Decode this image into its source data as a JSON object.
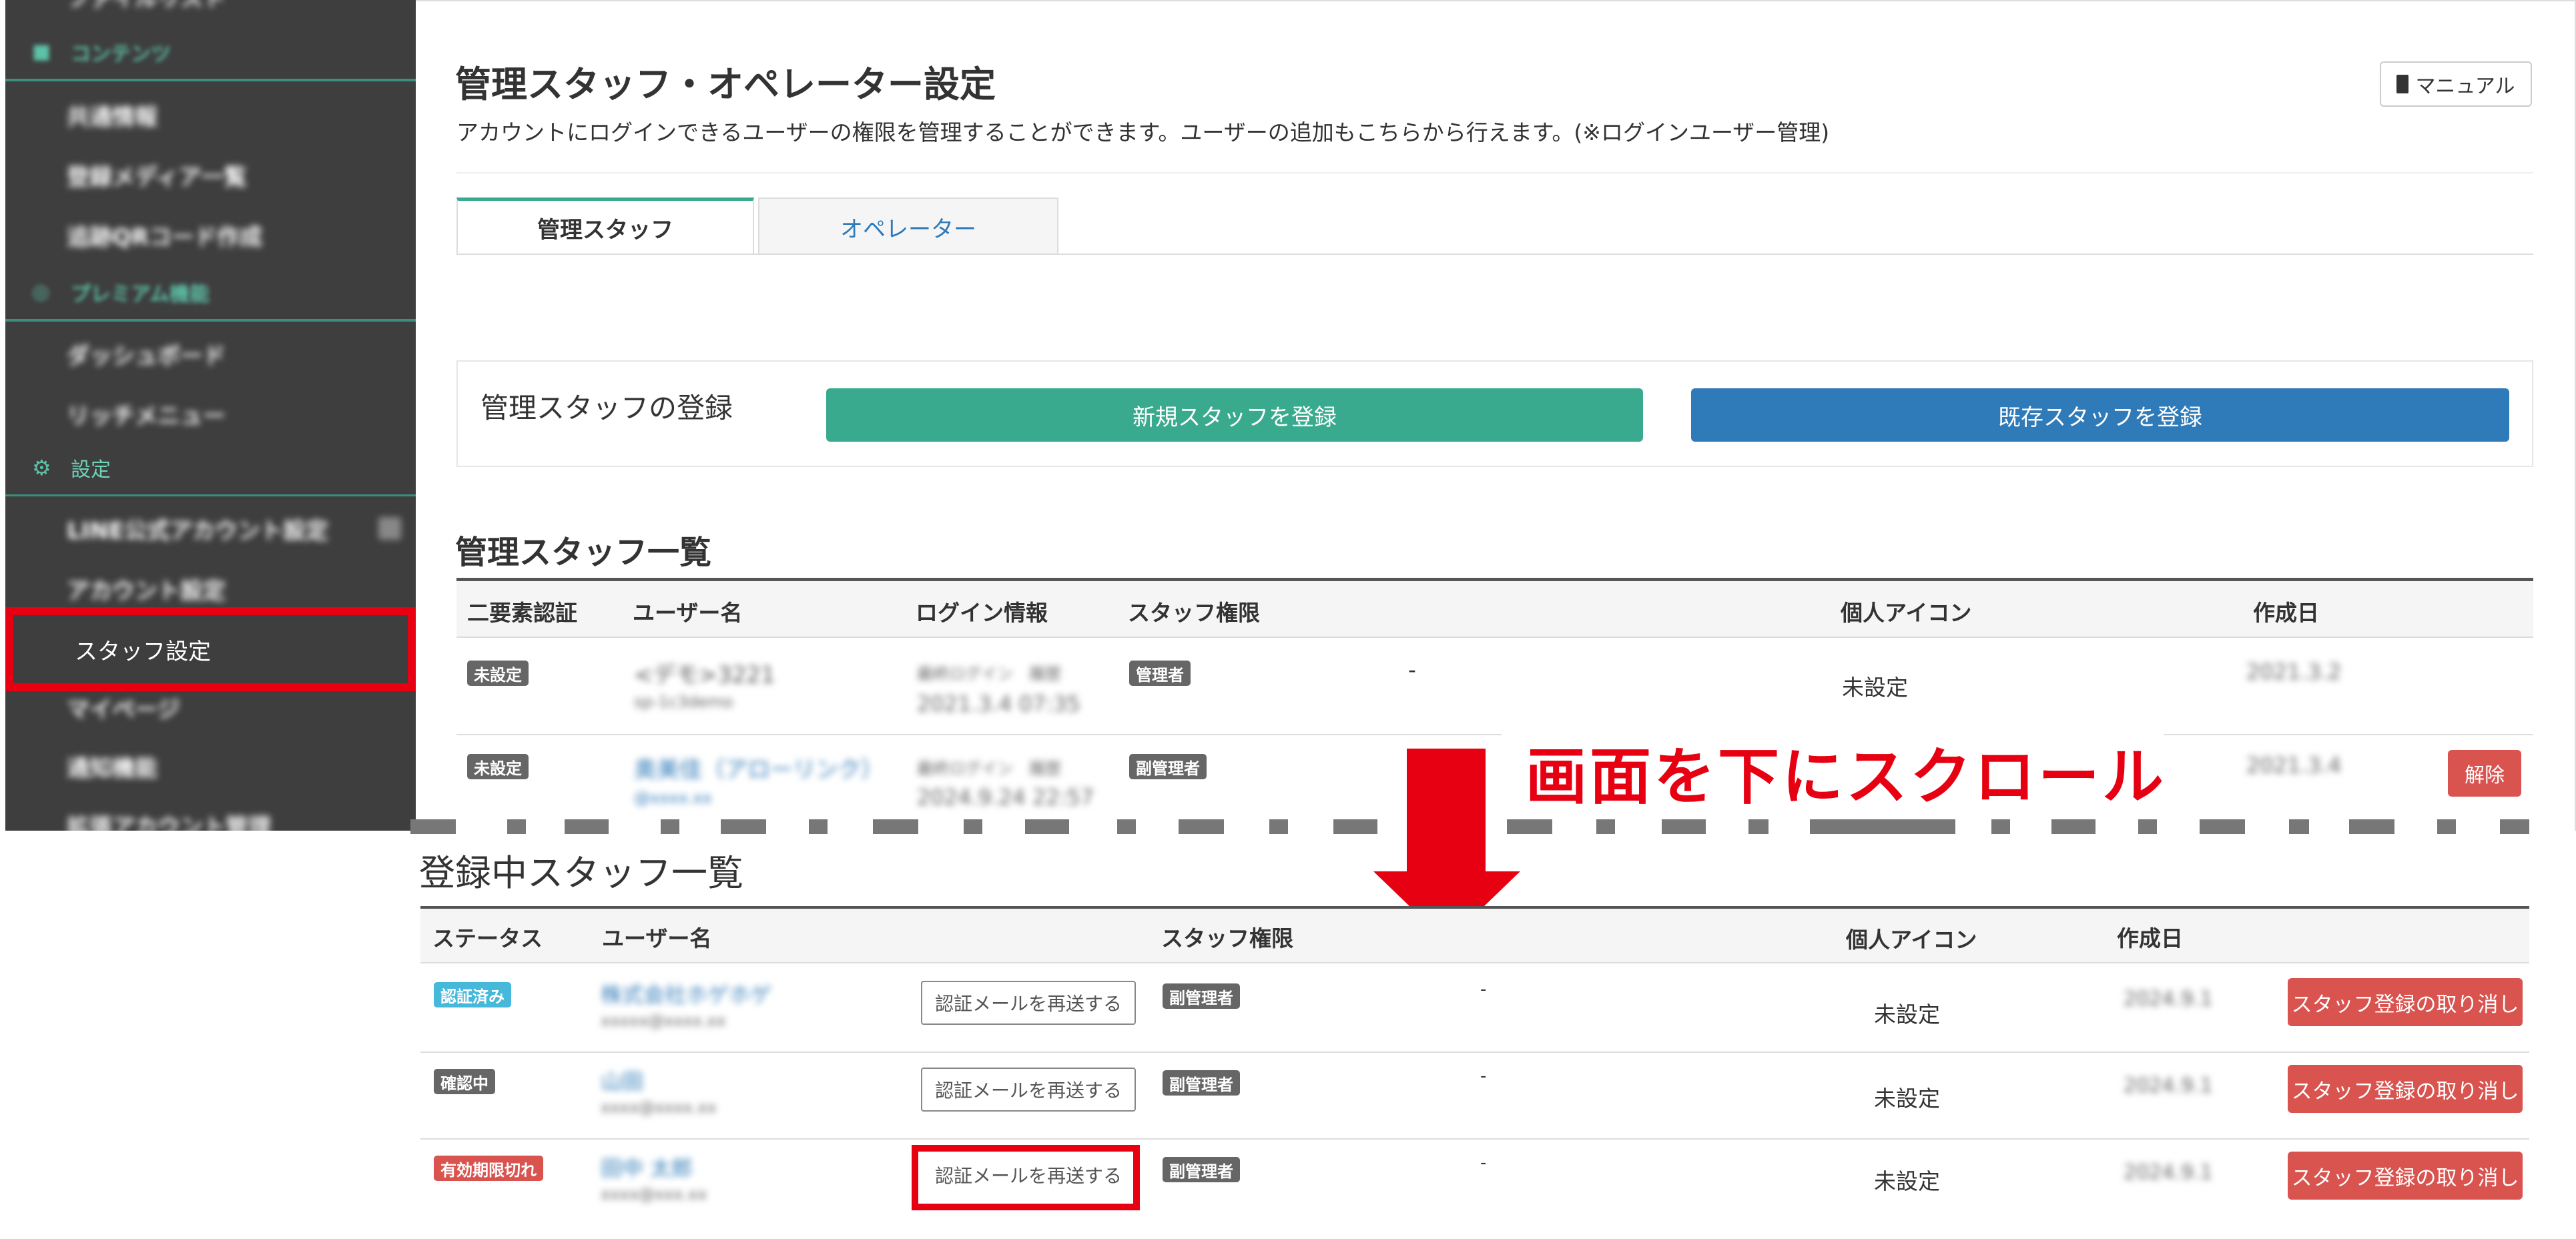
{
  "sidebar": {
    "sections": [
      {
        "icon": "folder-icon",
        "label": "コンテンツ"
      },
      {
        "icon": "premium-icon",
        "label": "プレミアム機能"
      },
      {
        "icon": "gear-icon",
        "label": "設定"
      }
    ],
    "top_partial_item": "ファイルリスト",
    "content_items": [
      "共通情報",
      "登録メディア一覧",
      "追跡QRコード作成"
    ],
    "premium_items": [
      "ダッシュボード",
      "リッチメニュー"
    ],
    "settings_items": [
      "LINE公式アカウント設定",
      "アカウント設定",
      "スタッフ設定",
      "マイページ",
      "通知機能",
      "拡張アカウント管理"
    ]
  },
  "header": {
    "title": "管理スタッフ・オペレーター設定",
    "subtitle": "アカウントにログインできるユーザーの権限を管理することができます。ユーザーの追加もこちらから行えます。(※ログインユーザー管理)",
    "manual_label": "マニュアル"
  },
  "tabs": [
    {
      "label": "管理スタッフ",
      "active": true
    },
    {
      "label": "オペレーター",
      "active": false
    }
  ],
  "register": {
    "label": "管理スタッフの登録",
    "new_button": "新規スタッフを登録",
    "existing_button": "既存スタッフを登録"
  },
  "staff_list": {
    "title": "管理スタッフ一覧",
    "columns": [
      "二要素認証",
      "ユーザー名",
      "ログイン情報",
      "スタッフ権限",
      "個人アイコン",
      "作成日"
    ],
    "rows": [
      {
        "two_factor": "未設定",
        "username": "<デモ>3221",
        "user_sub": "sp-1c3demo",
        "login_label": "最終ログイン　履歴",
        "login_time": "2021.3.4 07:35",
        "role": "管理者",
        "dash": "-",
        "icon": "未設定",
        "created": "2021.3.2"
      },
      {
        "two_factor": "未設定",
        "username": "奥美佳（アローリンク）",
        "user_sub": "@xxxx.xx",
        "login_label": "最終ログイン　履歴",
        "login_time": "2024.9.24 22:57",
        "role": "副管理者",
        "dash": "-",
        "icon": "",
        "created": "2021.3.4",
        "action": "解除"
      }
    ]
  },
  "annotation": "画面を下にスクロール",
  "registered_list": {
    "title": "登録中スタッフ一覧",
    "columns": [
      "ステータス",
      "ユーザー名",
      "スタッフ権限",
      "個人アイコン",
      "作成日"
    ],
    "resend_label": "認証メールを再送する",
    "cancel_label": "スタッフ登録の取り消し",
    "rows": [
      {
        "status": "認証済み",
        "status_color": "#46b8da",
        "username": "株式会社ホゲホゲ",
        "user_sub": "xxxxx@xxxx.xx",
        "role": "副管理者",
        "dash": "-",
        "icon": "未設定",
        "created": "2024.9.1"
      },
      {
        "status": "確認中",
        "status_color": "#666666",
        "username": "山田",
        "user_sub": "xxxx@xxxx.xx",
        "role": "副管理者",
        "dash": "-",
        "icon": "未設定",
        "created": "2024.9.1"
      },
      {
        "status": "有効期限切れ",
        "status_color": "#d9534f",
        "username": "田中 太郎",
        "user_sub": "xxxx@xxx.xx",
        "role": "副管理者",
        "dash": "-",
        "icon": "未設定",
        "created": "2024.9.1"
      }
    ]
  },
  "colors": {
    "accent_green": "#3aaa8e",
    "accent_blue": "#2f7ab8",
    "danger_red": "#d9534f",
    "highlight_red": "#e60012",
    "sidebar_bg": "#3e3e3e"
  }
}
